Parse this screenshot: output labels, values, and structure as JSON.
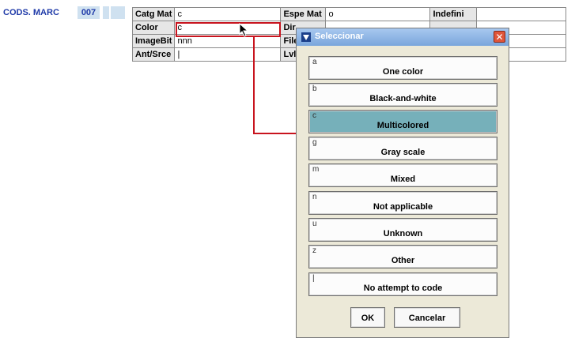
{
  "header": {
    "label": "CODS. MARC",
    "tag": "007"
  },
  "grid": {
    "rows": [
      [
        {
          "l": "Catg Mat",
          "v": "c"
        },
        {
          "l": "Espe Mat",
          "v": "o"
        },
        {
          "l": "Indefini",
          "v": ""
        }
      ],
      [
        {
          "l": "Color",
          "v": "c"
        },
        {
          "l": "Dir",
          "v": ""
        },
        {
          "l": "",
          "v": ""
        }
      ],
      [
        {
          "l": "ImageBit",
          "v": "nnn"
        },
        {
          "l": "File",
          "v": ""
        },
        {
          "l": "",
          "v": ""
        }
      ],
      [
        {
          "l": "Ant/Srce",
          "v": "|"
        },
        {
          "l": "Lvl",
          "v": ""
        },
        {
          "l": "",
          "v": ""
        }
      ]
    ]
  },
  "dialog": {
    "title": "Seleccionar",
    "selected_code": "c",
    "options": [
      {
        "code": "a",
        "label": "One color"
      },
      {
        "code": "b",
        "label": "Black-and-white"
      },
      {
        "code": "c",
        "label": "Multicolored"
      },
      {
        "code": "g",
        "label": "Gray scale"
      },
      {
        "code": "m",
        "label": "Mixed"
      },
      {
        "code": "n",
        "label": "Not applicable"
      },
      {
        "code": "u",
        "label": "Unknown"
      },
      {
        "code": "z",
        "label": "Other"
      },
      {
        "code": "|",
        "label": "No attempt to code"
      }
    ],
    "ok_label": "OK",
    "cancel_label": "Cancelar"
  }
}
